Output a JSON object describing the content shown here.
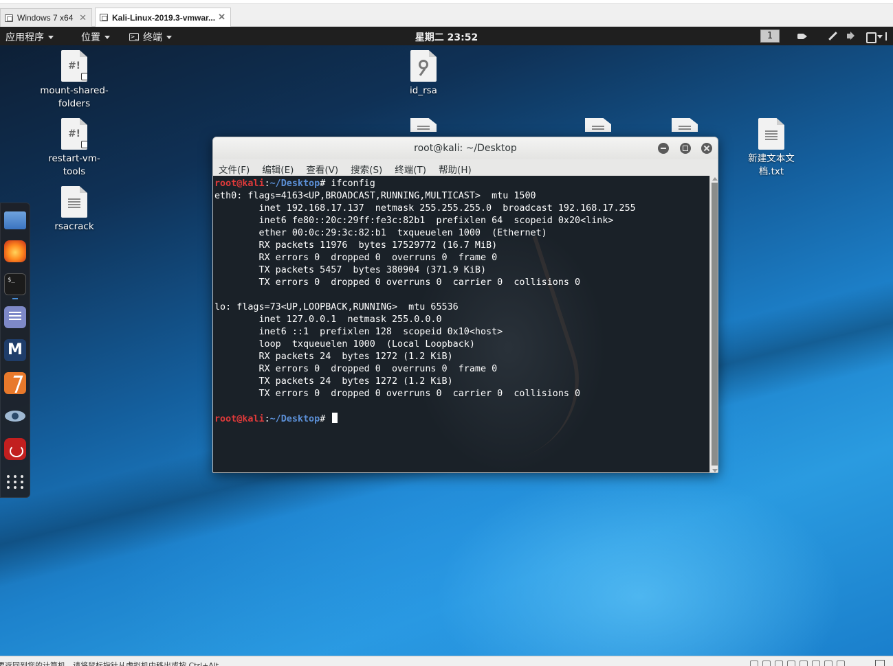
{
  "vm": {
    "tabs": [
      {
        "label": "Windows 7 x64"
      },
      {
        "label": "Kali-Linux-2019.3-vmwar..."
      }
    ],
    "status_hint": "要返回到您的计算机，请将鼠标指针从虚拟机中移出或按 Ctrl+Alt。"
  },
  "topbar": {
    "apps_label": "应用程序",
    "places_label": "位置",
    "terminal_label": "终端",
    "terminal_glyph": ">_",
    "clock": "星期二 23:52",
    "workspace": "1"
  },
  "desktop": {
    "icons": [
      {
        "label": "mount-shared-folders",
        "glyph": "#!"
      },
      {
        "label": "restart-vm-tools",
        "glyph": "#!"
      },
      {
        "label": "rsacrack"
      },
      {
        "label": "id_rsa"
      },
      {
        "label": "新建文本文档.txt"
      }
    ]
  },
  "dash": {
    "items": [
      "files-icon",
      "firefox-icon",
      "terminal-icon",
      "notes-icon",
      "metasploit-icon",
      "burpsuite-icon",
      "eye-icon",
      "cherrytree-icon",
      "show-apps-icon"
    ],
    "metasploit_glyph": "M",
    "terminal_glyph": "$_"
  },
  "terminal": {
    "title": "root@kali: ~/Desktop",
    "menu": [
      "文件(F)",
      "编辑(E)",
      "查看(V)",
      "搜索(S)",
      "终端(T)",
      "帮助(H)"
    ],
    "prompt_user": "root@kali",
    "prompt_sep": ":",
    "prompt_path": "~/Desktop",
    "prompt_end": "# ",
    "command": "ifconfig",
    "output": [
      "eth0: flags=4163<UP,BROADCAST,RUNNING,MULTICAST>  mtu 1500",
      "        inet 192.168.17.137  netmask 255.255.255.0  broadcast 192.168.17.255",
      "        inet6 fe80::20c:29ff:fe3c:82b1  prefixlen 64  scopeid 0x20<link>",
      "        ether 00:0c:29:3c:82:b1  txqueuelen 1000  (Ethernet)",
      "        RX packets 11976  bytes 17529772 (16.7 MiB)",
      "        RX errors 0  dropped 0  overruns 0  frame 0",
      "        TX packets 5457  bytes 380904 (371.9 KiB)",
      "        TX errors 0  dropped 0 overruns 0  carrier 0  collisions 0",
      "",
      "lo: flags=73<UP,LOOPBACK,RUNNING>  mtu 65536",
      "        inet 127.0.0.1  netmask 255.0.0.0",
      "        inet6 ::1  prefixlen 128  scopeid 0x10<host>",
      "        loop  txqueuelen 1000  (Local Loopback)",
      "        RX packets 24  bytes 1272 (1.2 KiB)",
      "        RX errors 0  dropped 0  overruns 0  frame 0",
      "        TX packets 24  bytes 1272 (1.2 KiB)",
      "        TX errors 0  dropped 0 overruns 0  carrier 0  collisions 0",
      ""
    ]
  }
}
